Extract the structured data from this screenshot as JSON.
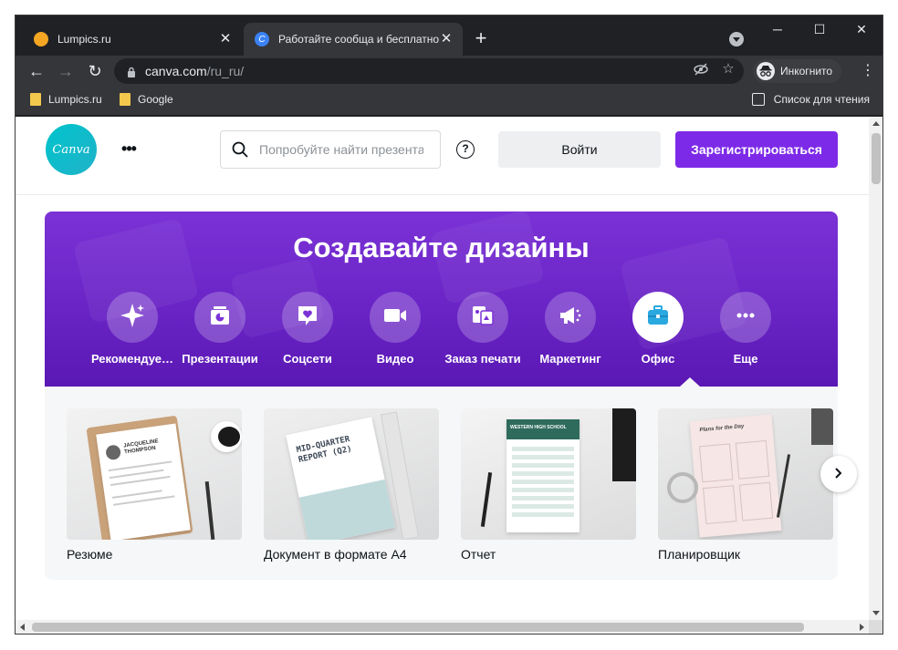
{
  "browser": {
    "tabs": [
      {
        "title": "Lumpics.ru",
        "favicon_color": "#f5a623",
        "active": false
      },
      {
        "title": "Работайте сообща и бесплатно",
        "favicon_color": "#3b82f6",
        "active": true
      }
    ],
    "new_tab_label": "+",
    "window_controls": {
      "minimize": "─",
      "maximize": "☐",
      "close": "✕"
    },
    "url": {
      "host": "canva.com",
      "path": "/ru_ru/"
    },
    "incognito_label": "Инкогнито",
    "bookmarks": [
      "Lumpics.ru",
      "Google"
    ],
    "reading_list_label": "Список для чтения"
  },
  "canva": {
    "logo_text": "Canva",
    "search_placeholder": "Попробуйте найти презентации",
    "help_label": "?",
    "login_label": "Войти",
    "signup_label": "Зарегистрироваться",
    "hero_title": "Создавайте дизайны",
    "categories": [
      {
        "label": "Рекомендуе…",
        "icon": "sparkle-icon"
      },
      {
        "label": "Презентации",
        "icon": "presentation-icon"
      },
      {
        "label": "Соцсети",
        "icon": "heart-chat-icon"
      },
      {
        "label": "Видео",
        "icon": "video-camera-icon"
      },
      {
        "label": "Заказ печати",
        "icon": "print-icon"
      },
      {
        "label": "Маркетинг",
        "icon": "megaphone-icon"
      },
      {
        "label": "Офис",
        "icon": "briefcase-icon",
        "active": true
      },
      {
        "label": "Еще",
        "icon": "more-dots-icon"
      }
    ],
    "cards": [
      {
        "caption": "Резюме",
        "thumb_text": "JACQUELINE THOMPSON"
      },
      {
        "caption": "Документ в формате А4",
        "thumb_text": "MID-QUARTER REPORT (Q2)"
      },
      {
        "caption": "Отчет",
        "thumb_text": "WESTERN HIGH SCHOOL"
      },
      {
        "caption": "Планировщик",
        "thumb_text": "Plans for the Day"
      }
    ],
    "brand_colors": {
      "purple": "#7d2ae8",
      "teal": "#00c4cc"
    }
  }
}
